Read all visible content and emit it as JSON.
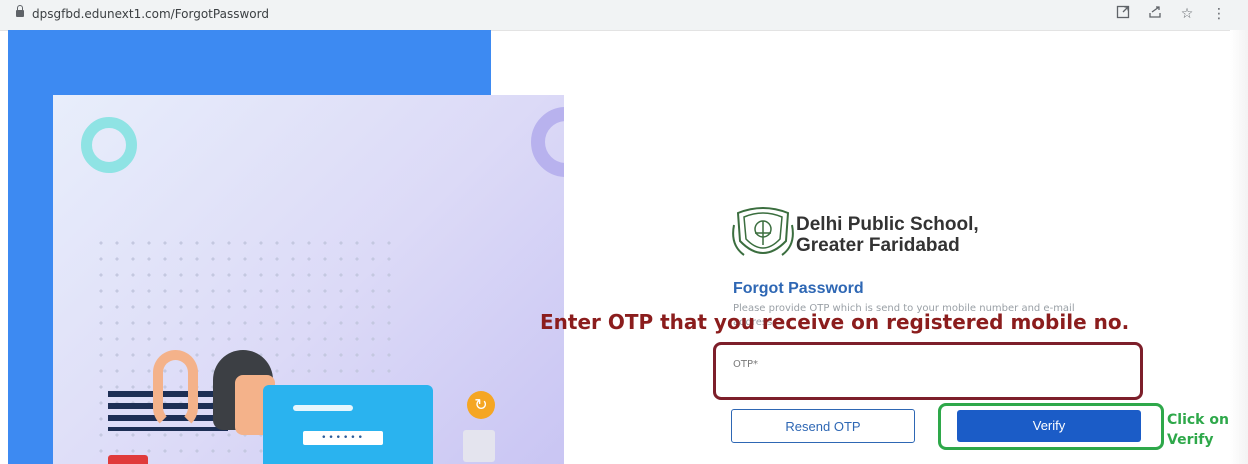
{
  "browser": {
    "url": "dpsgfbd.edunext1.com/ForgotPassword",
    "icons": [
      "external-link-icon",
      "share-icon",
      "star-icon"
    ]
  },
  "illustration": {
    "password_mask": "••••••"
  },
  "form": {
    "school_name_line1": "Delhi Public School,",
    "school_name_line2": "Greater Faridabad",
    "title": "Forgot Password",
    "description": "Please provide OTP which is send to your mobile number and e-mail address.",
    "otp_label": "OTP*",
    "otp_value": "",
    "resend_label": "Resend OTP",
    "verify_label": "Verify"
  },
  "annotations": {
    "otp_instruction": "Enter OTP that you receive on registered mobile no.",
    "verify_line1": "Click on",
    "verify_line2": "Verify"
  },
  "colors": {
    "panel_blue": "#3d8af2",
    "brand_blue": "#2e67b4",
    "verify_blue": "#1b5cc7",
    "annotation_red": "#8b1d1d",
    "annotation_green": "#2ea84a"
  }
}
